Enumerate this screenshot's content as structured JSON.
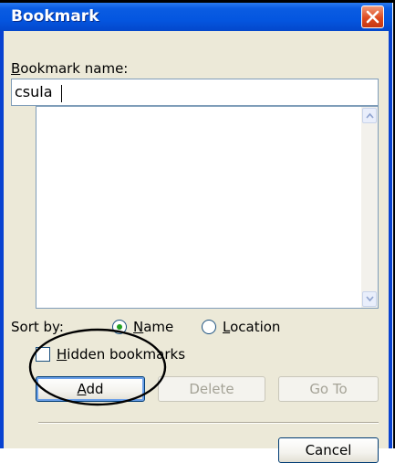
{
  "window": {
    "title": "Bookmark",
    "close_icon": "close-icon"
  },
  "name_field": {
    "label_prefix": "",
    "label_mnemonic": "B",
    "label_rest": "ookmark name:",
    "value": "csula"
  },
  "bookmark_list": {
    "items": []
  },
  "sort": {
    "label": "Sort by:",
    "selected": "Name",
    "options": [
      {
        "mnemonic": "N",
        "rest": "ame"
      },
      {
        "mnemonic": "L",
        "rest": "ocation"
      }
    ]
  },
  "hidden_bookmarks": {
    "checked": false,
    "mnemonic": "H",
    "rest": "idden bookmarks"
  },
  "buttons": {
    "add_mnemonic": "A",
    "add_rest": "dd",
    "delete": "Delete",
    "goto": "Go To",
    "cancel": "Cancel"
  },
  "colors": {
    "titlebar": "#0a5ce2",
    "dialog_bg": "#ece9d8",
    "radio_dot": "#21a121"
  }
}
